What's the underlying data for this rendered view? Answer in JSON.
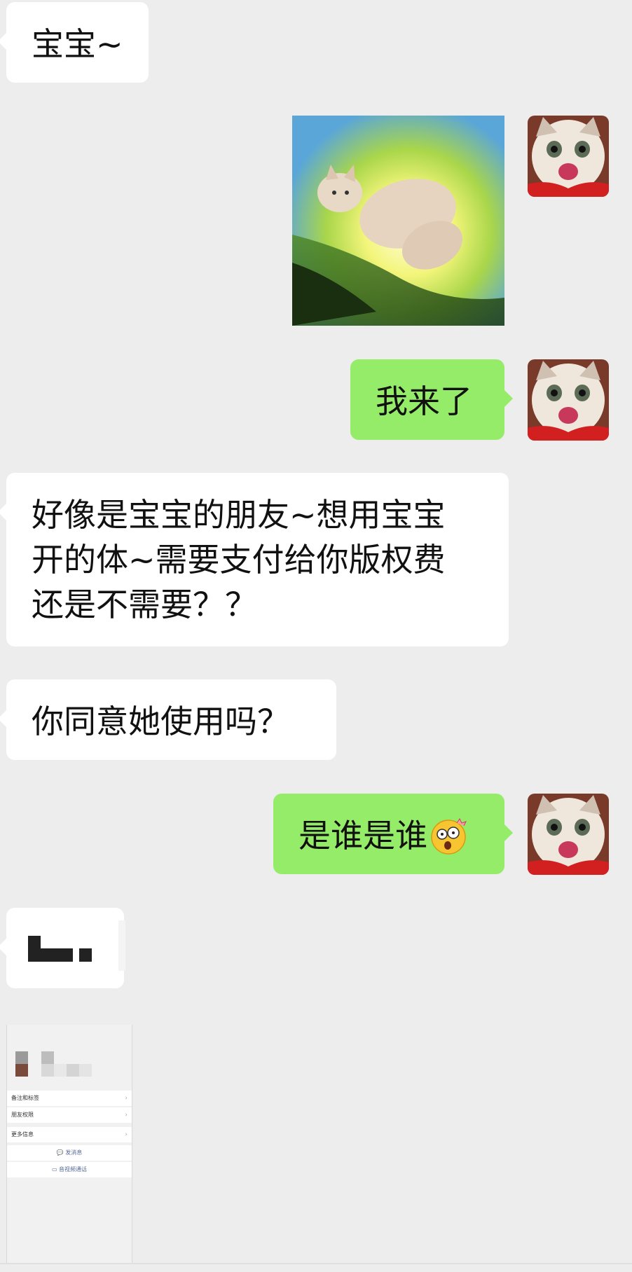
{
  "messages": {
    "m1": "宝宝~",
    "m3": "我来了",
    "m4_line1": "好像是宝宝的朋友~想用宝宝",
    "m4_line2": "开的体~需要支付给你版权费",
    "m4_line3": "还是不需要？？",
    "m5": "你同意她使用吗？",
    "m6": "是谁是谁"
  },
  "icons": {
    "avatar": "cat-avatar-icon",
    "sticker": "flying-cat-sticker",
    "emoji": "shocked-face-emoji"
  },
  "profile_screenshot": {
    "rows": [
      "备注和标签",
      "朋友权限",
      "更多信息"
    ],
    "send_message": "发消息",
    "video_call": "音视频通话"
  },
  "colors": {
    "background": "#ededed",
    "incoming_bubble": "#ffffff",
    "outgoing_bubble": "#95ec69",
    "link_blue": "#576b95"
  }
}
